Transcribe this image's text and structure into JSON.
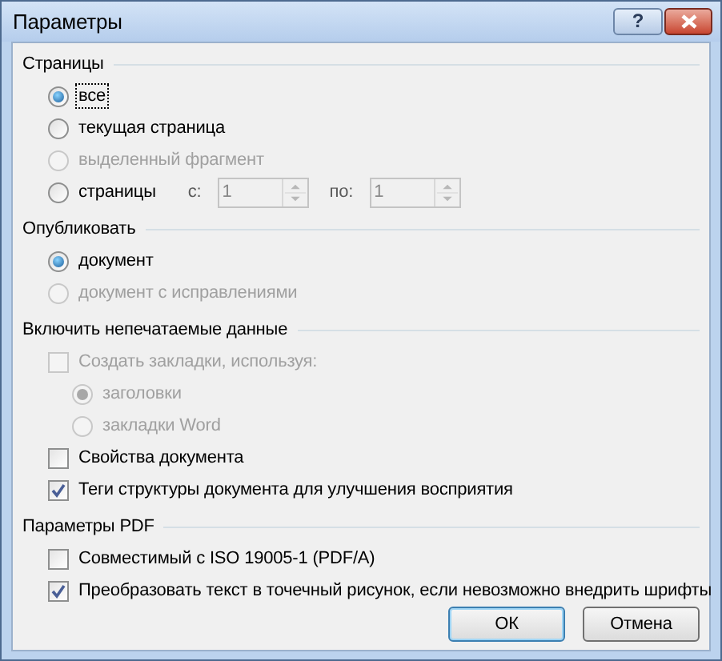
{
  "window": {
    "title": "Параметры",
    "help_button": "?"
  },
  "sections": [
    {
      "title": "Страницы",
      "items": [
        {
          "kind": "radio",
          "label": "все",
          "selected": true,
          "disabled": false,
          "focused": true
        },
        {
          "kind": "radio",
          "label": "текущая страница",
          "selected": false,
          "disabled": false,
          "focused": false
        },
        {
          "kind": "radio",
          "label": "выделенный фрагмент",
          "selected": false,
          "disabled": true,
          "focused": false
        },
        {
          "kind": "radio",
          "label": "страницы",
          "selected": false,
          "disabled": false,
          "focused": false,
          "range": [
            {
              "label": "с:",
              "value": "1",
              "disabled": true
            },
            {
              "label": "по:",
              "value": "1",
              "disabled": true
            }
          ]
        }
      ]
    },
    {
      "title": "Опубликовать",
      "items": [
        {
          "kind": "radio",
          "label": "документ",
          "selected": true,
          "disabled": false,
          "focused": false
        },
        {
          "kind": "radio",
          "label": "документ с исправлениями",
          "selected": false,
          "disabled": true,
          "focused": false
        }
      ]
    },
    {
      "title": "Включить непечатаемые данные",
      "items": [
        {
          "kind": "checkbox",
          "label": "Создать закладки, используя:",
          "checked": false,
          "disabled": true,
          "focused": false,
          "children": [
            {
              "kind": "radio",
              "label": "заголовки",
              "selected": true,
              "disabled": true,
              "focused": false
            },
            {
              "kind": "radio",
              "label": "закладки Word",
              "selected": false,
              "disabled": true,
              "focused": false
            }
          ]
        },
        {
          "kind": "checkbox",
          "label": "Свойства документа",
          "checked": false,
          "disabled": false,
          "focused": false
        },
        {
          "kind": "checkbox",
          "label": "Теги структуры документа для улучшения восприятия",
          "checked": true,
          "disabled": false,
          "focused": false
        }
      ]
    },
    {
      "title": "Параметры PDF",
      "items": [
        {
          "kind": "checkbox",
          "label": "Совместимый с ISO 19005-1 (PDF/A)",
          "checked": false,
          "disabled": false,
          "focused": false
        },
        {
          "kind": "checkbox",
          "label": "Преобразовать текст в точечный рисунок, если невозможно внедрить шрифты",
          "checked": true,
          "disabled": false,
          "focused": false
        }
      ]
    }
  ],
  "buttons": [
    {
      "label": "ОК",
      "default": true
    },
    {
      "label": "Отмена",
      "default": false
    }
  ]
}
